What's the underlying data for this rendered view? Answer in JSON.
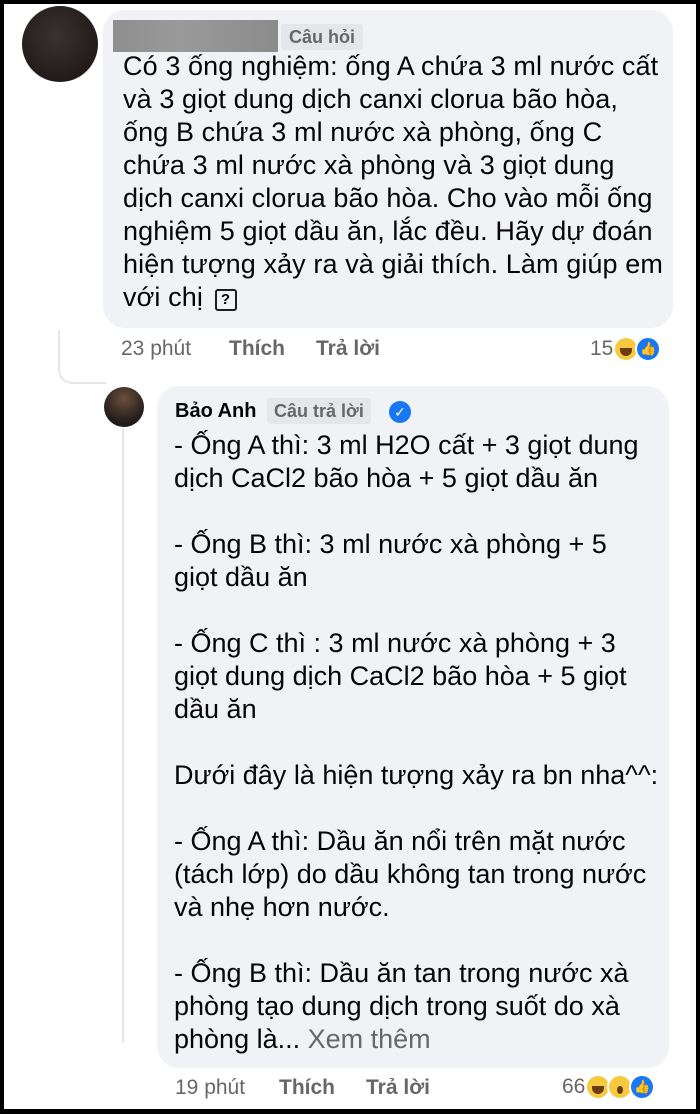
{
  "question": {
    "badge": "Câu hỏi",
    "lines": [
      "Có 3 ống nghiệm: ống A chứa 3 ml nước cất",
      "và 3 giọt dung dịch canxi clorua bão hòa,",
      "ống B chứa 3 ml nước xà phòng, ống C",
      "chứa 3 ml nước xà phòng và 3 giọt dung",
      "dịch canxi clorua bão hòa. Cho vào mỗi ống",
      "nghiệm 5 giọt dầu ăn, lắc đều. Hãy dự đoán",
      "hiện tượng xảy ra và giải thích. Làm giúp em",
      "với chị"
    ],
    "emoji": "?",
    "time": "23 phút",
    "like_label": "Thích",
    "reply_label": "Trả lời",
    "reaction_count": "15",
    "reactions": [
      "haha-icon",
      "like-icon"
    ]
  },
  "answer": {
    "author": "Bảo Anh",
    "badge": "Câu trả lời",
    "verified_icon": "verified-badge-icon",
    "paragraphs": [
      [
        "- Ống A thì: 3 ml H2O cất + 3 giọt dung",
        "dịch CaCl2 bão hòa + 5 giọt dầu ăn"
      ],
      [
        "- Ống B thì: 3 ml nước xà phòng + 5",
        "giọt dầu ăn"
      ],
      [
        "- Ống C thì : 3 ml nước xà phòng + 3",
        "giọt dung dịch CaCl2 bão hòa + 5 giọt",
        "dầu ăn"
      ],
      [
        "Dưới đây là hiện tượng xảy ra bn nha^^:"
      ],
      [
        "- Ống A thì: Dầu ăn nổi trên mặt nước",
        "(tách lớp) do dầu không tan trong nước",
        "và nhẹ hơn nước."
      ],
      [
        "- Ống B thì: Dầu ăn tan trong nước xà",
        "phòng tạo dung dịch trong suốt do xà"
      ]
    ],
    "last_line": "phòng là...",
    "see_more": "Xem thêm",
    "time": "19 phút",
    "like_label": "Thích",
    "reply_label": "Trả lời",
    "reaction_count": "66",
    "reactions": [
      "haha-icon",
      "wow-icon",
      "like-icon"
    ]
  }
}
